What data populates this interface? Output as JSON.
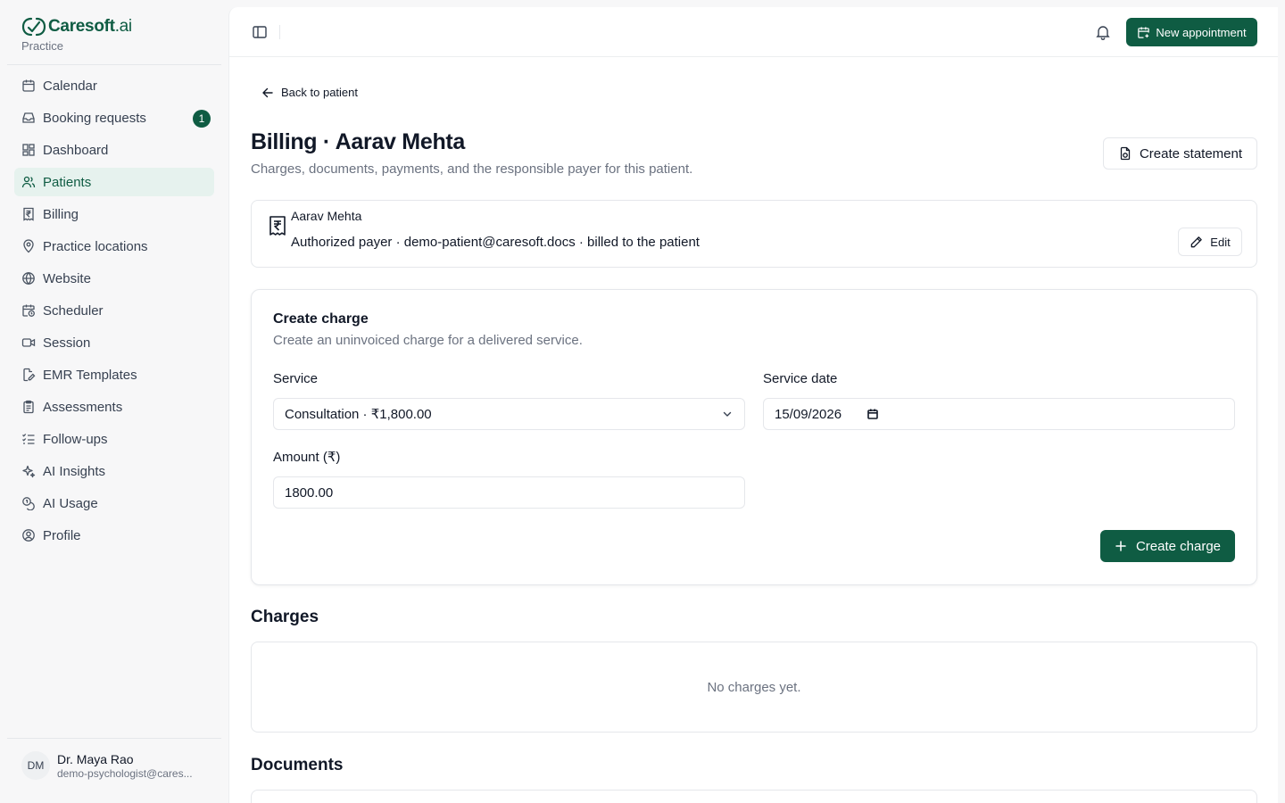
{
  "brand": {
    "name": "Caresoft",
    "suffix": ".ai",
    "subtitle": "Practice"
  },
  "sidebar": {
    "items": [
      {
        "label": "Calendar",
        "icon": "calendar-icon"
      },
      {
        "label": "Booking requests",
        "icon": "inbox-icon",
        "badge": "1"
      },
      {
        "label": "Dashboard",
        "icon": "dashboard-icon"
      },
      {
        "label": "Patients",
        "icon": "users-icon",
        "active": true
      },
      {
        "label": "Billing",
        "icon": "rupee-receipt-icon"
      },
      {
        "label": "Practice locations",
        "icon": "map-pin-icon"
      },
      {
        "label": "Website",
        "icon": "globe-icon"
      },
      {
        "label": "Scheduler",
        "icon": "calendar-clock-icon"
      },
      {
        "label": "Session",
        "icon": "video-icon"
      },
      {
        "label": "EMR Templates",
        "icon": "file-edit-icon"
      },
      {
        "label": "Assessments",
        "icon": "clipboard-icon"
      },
      {
        "label": "Follow-ups",
        "icon": "list-checks-icon"
      },
      {
        "label": "AI Insights",
        "icon": "sparkles-icon"
      },
      {
        "label": "AI Usage",
        "icon": "coins-icon"
      },
      {
        "label": "Profile",
        "icon": "user-circle-icon"
      }
    ]
  },
  "user": {
    "initials": "DM",
    "name": "Dr. Maya Rao",
    "email": "demo-psychologist@cares..."
  },
  "topbar": {
    "new_appointment_label": "New appointment"
  },
  "page": {
    "back_label": "Back to patient",
    "title": "Billing · Aarav Mehta",
    "subtitle": "Charges, documents, payments, and the responsible payer for this patient.",
    "create_statement_label": "Create statement"
  },
  "payer": {
    "name": "Aarav Mehta",
    "detail": "Authorized payer · demo-patient@caresoft.docs · billed to the patient",
    "edit_label": "Edit"
  },
  "create_charge": {
    "title": "Create charge",
    "subtitle": "Create an uninvoiced charge for a delivered service.",
    "service_label": "Service",
    "service_value": "Consultation · ₹1,800.00",
    "date_label": "Service date",
    "date_value": "15/09/2026",
    "amount_label": "Amount (₹)",
    "amount_value": "1800.00",
    "submit_label": "Create charge"
  },
  "charges": {
    "title": "Charges",
    "empty_text": "No charges yet."
  },
  "documents": {
    "title": "Documents"
  },
  "colors": {
    "brand": "#0f5c43",
    "active_bg": "#e6f2ee"
  }
}
